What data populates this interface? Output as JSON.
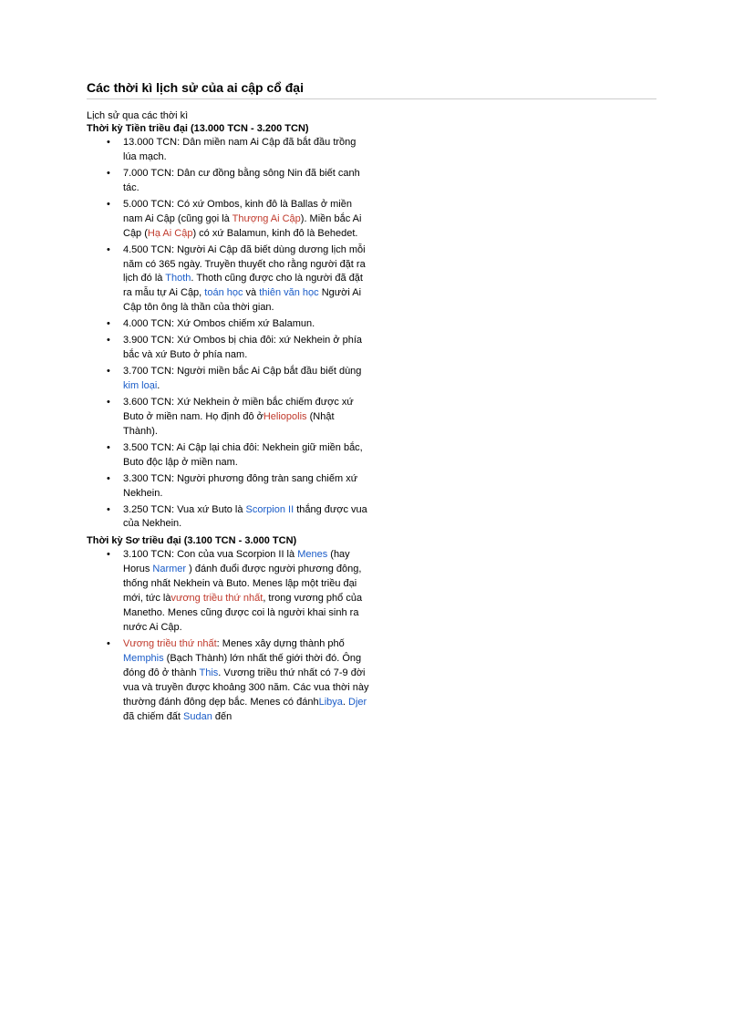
{
  "title": "Các thời kì lịch sử của ai cập cổ đại",
  "intro": "Lịch sử qua các thời kì",
  "sections": [
    {
      "title": "Thời kỳ Tiền triều đại (13.000 TCN - 3.200 TCN)",
      "items": [
        {
          "segments": [
            {
              "t": "13.000 TCN: Dân miền nam Ai Cập đã bắt đầu trồng lúa mạch."
            }
          ]
        },
        {
          "segments": [
            {
              "t": "7.000 TCN: Dân cư đồng bằng sông Nin đã biết canh tác."
            }
          ]
        },
        {
          "segments": [
            {
              "t": "5.000 TCN: Có xứ Ombos, kinh đô là Ballas ở miền nam Ai Cập (cũng gọi là "
            },
            {
              "t": "Thượng Ai Cập",
              "link": "red"
            },
            {
              "t": "). Miền bắc Ai Cập ("
            },
            {
              "t": "Hạ Ai Cập",
              "link": "red"
            },
            {
              "t": ") có xứ Balamun,  kinh đô là Behedet."
            }
          ]
        },
        {
          "segments": [
            {
              "t": "4.500 TCN: Người Ai Cập đã biết dùng dương lịch mỗi năm  có 365 ngày. Truyền thuyết cho rằng người đặt ra lịch đó là "
            },
            {
              "t": "Thoth",
              "link": "blue"
            },
            {
              "t": ". Thoth cũng được cho là người đã đặt ra mẫu tự Ai Cập, "
            },
            {
              "t": "toán học",
              "link": "blue"
            },
            {
              "t": " và "
            },
            {
              "t": "thiên văn học",
              "link": "blue"
            },
            {
              "t": " Người Ai Cập tôn ông là thần của thời gian."
            }
          ]
        },
        {
          "segments": [
            {
              "t": "4.000 TCN: Xứ Ombos chiếm xứ Balamun."
            }
          ]
        },
        {
          "segments": [
            {
              "t": "3.900 TCN: Xứ Ombos bị chia đôi: xứ Nekhein ở phía bắc và xứ Buto ở phía nam."
            }
          ]
        },
        {
          "segments": [
            {
              "t": "3.700 TCN: Người miền bắc Ai Cập bắt đầu biết dùng "
            },
            {
              "t": "kim  loại",
              "link": "blue"
            },
            {
              "t": "."
            }
          ]
        },
        {
          "segments": [
            {
              "t": "3.600 TCN: Xứ Nekhein ở miền bắc chiếm được xứ Buto ở miền nam. Họ định đô ở"
            },
            {
              "t": "Heliopolis",
              "link": "red"
            },
            {
              "t": " (Nhật Thành)."
            }
          ]
        },
        {
          "segments": [
            {
              "t": "3.500 TCN: Ai Cập lại chia đôi: Nekhein giữ miền bắc, Buto độc lập ở miền nam."
            }
          ]
        },
        {
          "segments": [
            {
              "t": "3.300 TCN: Người phương đông tràn sang chiếm xứ Nekhein."
            }
          ]
        },
        {
          "segments": [
            {
              "t": "3.250 TCN: Vua xứ Buto là "
            },
            {
              "t": "Scorpion II",
              "link": "blue"
            },
            {
              "t": " thắng được vua của Nekhein."
            }
          ]
        }
      ]
    },
    {
      "title": "Thời kỳ Sơ triều đại (3.100 TCN - 3.000 TCN)",
      "items": [
        {
          "segments": [
            {
              "t": "3.100 TCN: Con của vua Scorpion II là "
            },
            {
              "t": "Menes",
              "link": "blue"
            },
            {
              "t": " (hay Horus "
            },
            {
              "t": "Narmer",
              "link": "blue"
            },
            {
              "t": " ) đánh đuổi được người phương đông, thống nhất Nekhein  và Buto. Menes lập một triều đại mới, tức là"
            },
            {
              "t": "vương triều thứ nhất",
              "link": "red"
            },
            {
              "t": ", trong vương phổ của Manetho. Menes cũng được coi là người khai sinh ra nước Ai Cập."
            }
          ]
        },
        {
          "segments": [
            {
              "t": "Vương triều thứ nhất",
              "link": "red"
            },
            {
              "t": ": Menes xây dựng thành phố "
            },
            {
              "t": "Memphis",
              "link": "blue"
            },
            {
              "t": " (Bạch Thành) lớn nhất thế giới thời đó. Ông đóng đô ở thành "
            },
            {
              "t": "This",
              "link": "blue"
            },
            {
              "t": ". Vương triều thứ nhất có 7-9 đời vua và truyền được khoảng 300 năm. Các vua thời này thường đánh đông dẹp bắc. Menes có đánh"
            },
            {
              "t": "Libya",
              "link": "blue"
            },
            {
              "t": ". "
            },
            {
              "t": "Djer",
              "link": "blue"
            },
            {
              "t": " đã chiếm đất "
            },
            {
              "t": "Sudan",
              "link": "blue"
            },
            {
              "t": " đến"
            }
          ]
        }
      ]
    }
  ]
}
